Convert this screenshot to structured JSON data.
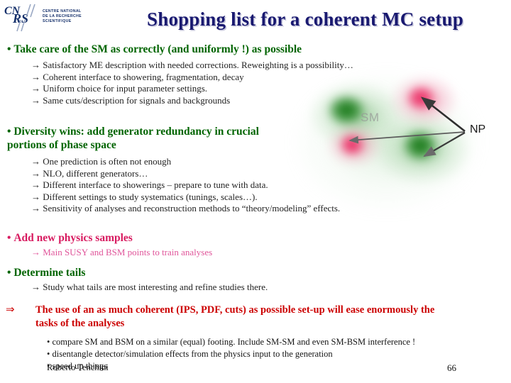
{
  "logo": {
    "acronym": "CNRS",
    "line1": "CENTRE NATIONAL",
    "line2": "DE LA RECHERCHE",
    "line3": "SCIENTIFIQUE"
  },
  "title": "Shopping list for a coherent MC setup",
  "graphic": {
    "label_sm": "SM",
    "label_np": "NP"
  },
  "sections": [
    {
      "bullet": "Take care of the SM as correctly (and uniformly !) as possible",
      "color": "#006400",
      "subs": [
        "→ Satisfactory ME description with needed corrections. Reweighting is a possibility…",
        "→ Coherent interface to showering, fragmentation, decay",
        "→ Uniform choice for input parameter settings.",
        "→ Same cuts/description for signals and backgrounds"
      ]
    },
    {
      "bullet": "Diversity wins: add generator redundancy in crucial portions of phase space",
      "color": "#006400",
      "subs": [
        "→ One prediction is often not enough",
        "→ NLO, different generators…",
        "→ Different interface to showerings – prepare to tune with data.",
        "→ Different settings to study systematics (tunings, scales…).",
        "→ Sensitivity of analyses and reconstruction methods to “theory/modeling” effects."
      ]
    },
    {
      "bullet": "Add new physics samples",
      "color": "#d81b60",
      "subs": [
        "→ Main SUSY and BSM points to train analyses"
      ]
    },
    {
      "bullet": "Determine tails",
      "color": "#006400",
      "subs": [
        "→ Study what tails are most interesting and refine studies there."
      ]
    }
  ],
  "conclusion": {
    "arrow": "⇒",
    "line1": "The use of an as much coherent (IPS, PDF, cuts) as possible set-up will ease enormously the",
    "line2": "tasks of the analyses",
    "color": "#cc0000"
  },
  "tail_bullets": [
    "• compare SM and BSM on a similar (equal) footing. Include SM-SM and even SM-BSM interference !",
    "• disentangle detector/simulation effects from the physics input to the generation",
    "• speed up things"
  ],
  "footer": {
    "presenter": "Roberto Tenchini",
    "page_number": "66"
  }
}
